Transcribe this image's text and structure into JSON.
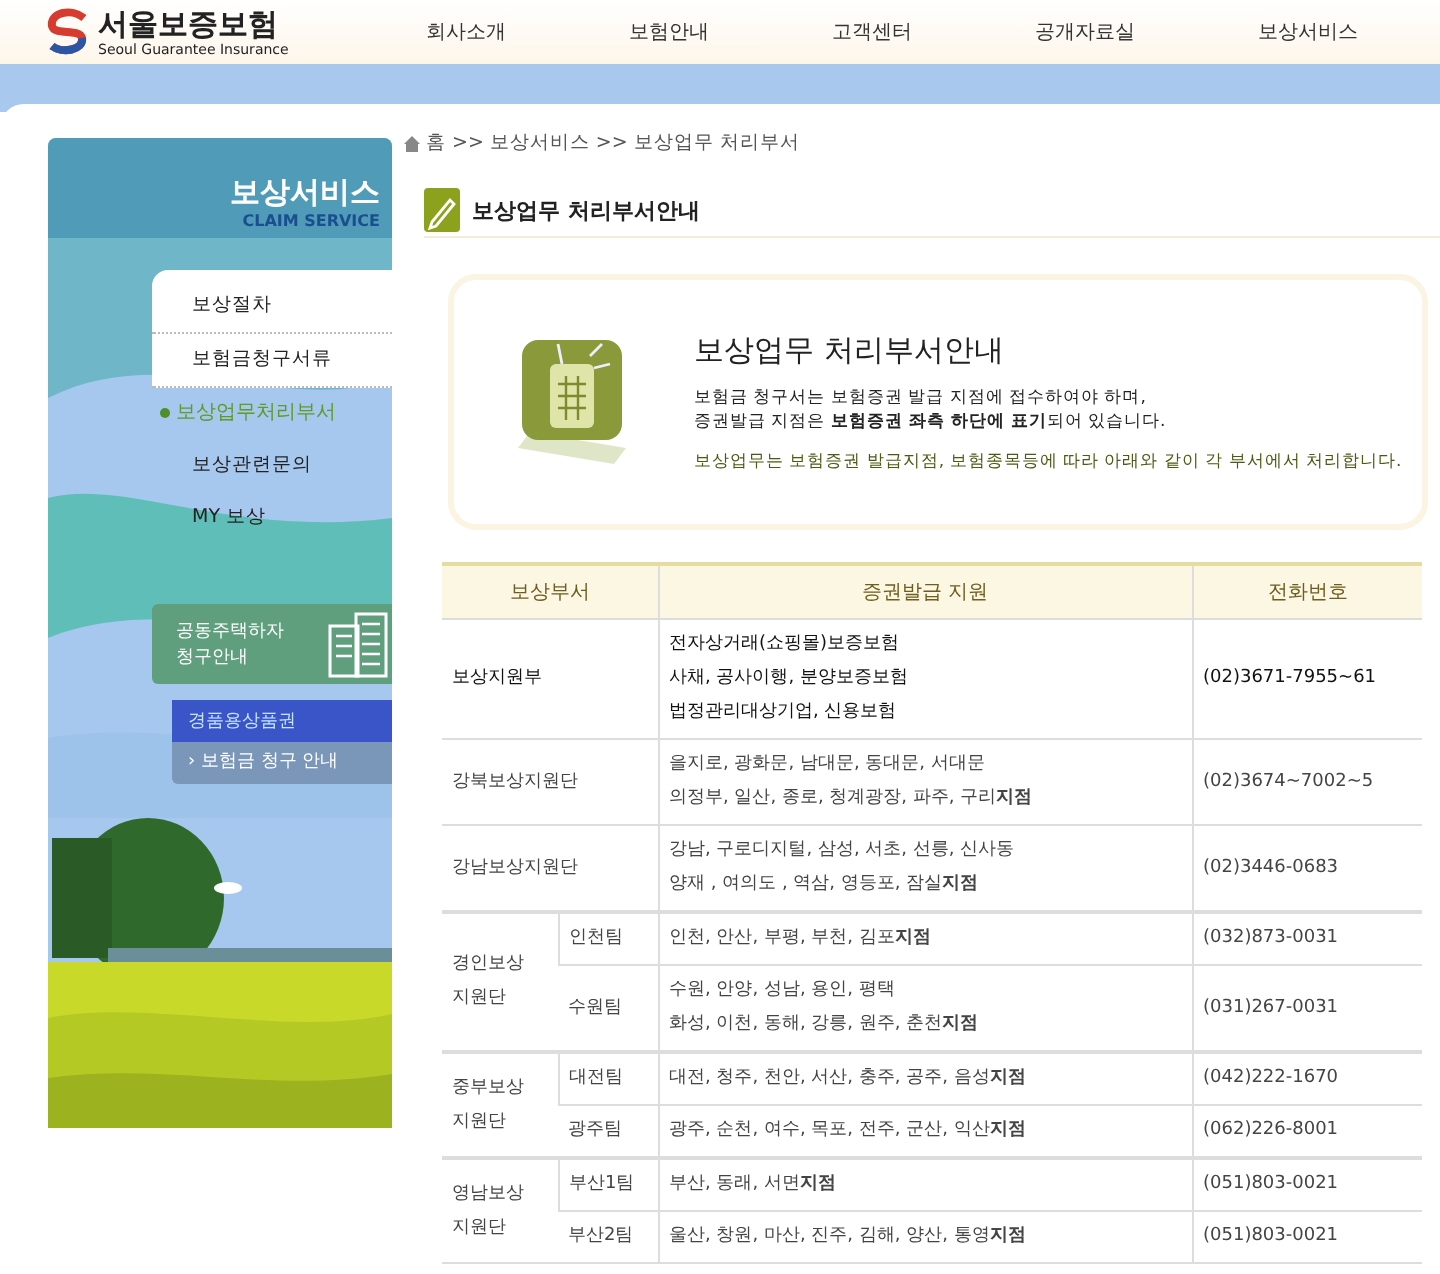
{
  "logo": {
    "name": "서울보증보험",
    "tagline": "Seoul Guarantee Insurance"
  },
  "nav": [
    "회사소개",
    "보험안내",
    "고객센터",
    "공개자료실",
    "보상서비스"
  ],
  "sidebar": {
    "title": "보상서비스",
    "subtitle": "CLAIM SERVICE",
    "items": [
      {
        "label": "보상절차",
        "selected": false
      },
      {
        "label": "보험금청구서류",
        "selected": false
      },
      {
        "label": "보상업무처리부서",
        "selected": true
      },
      {
        "label": "보상관련문의",
        "selected": false
      },
      {
        "label": "MY 보상",
        "selected": false
      }
    ],
    "banners": [
      {
        "kind": "housing",
        "text": "공동주택하자 청구안내"
      },
      {
        "kind": "voucher",
        "text": "경품용상품권",
        "link": "› 보험금 청구 안내"
      }
    ]
  },
  "breadcrumb": [
    "홈",
    ">>",
    "보상서비스",
    ">>",
    "보상업무 처리부서"
  ],
  "page_title": "보상업무 처리부서안내",
  "intro": {
    "heading": "보상업무 처리부서안내",
    "lines": [
      "보험금 청구서는 보험증권 발급 지점에 접수하여야 하며,",
      "증권발급 지점은 **보험증권 좌측 하단에 표기**되어 있습니다."
    ],
    "note": "보상업무는 보험증권 발급지점, 보험종목등에 따라 아래와 같이 각 부서에서 처리합니다."
  },
  "table": {
    "columns": [
      "보상부서",
      "증권발급 지원",
      "전화번호"
    ],
    "rows": [
      {
        "dept": "보상지원부",
        "branches": [
          "전자상거래(쇼핑몰)보증보험",
          "사채, 공사이행, 분양보증보험",
          "법정관리대상기업, 신용보험"
        ],
        "phone": "(02)3671-7955~61"
      },
      {
        "dept": "강북보상지원단",
        "branches": [
          "을지로, 광화문, 남대문, 동대문, 서대문",
          "의정부, 일산, 종로, 청계광장, 파주, 구리**지점**"
        ],
        "phone": "(02)3674~7002~5"
      },
      {
        "dept": "강남보상지원단",
        "branches": [
          "강남, 구로디지털, 삼성, 서초, 선릉, 신사동",
          "양재 , 여의도 , 역삼, 영등포, 잠실**지점**"
        ],
        "phone": "(02)3446-0683"
      },
      {
        "dept": "경인보상 지원단",
        "teams": [
          {
            "team": "인천팀",
            "branches": [
              "인천, 안산, 부평, 부천, 김포**지점**"
            ],
            "phone": "(032)873-0031"
          },
          {
            "team": "수원팀",
            "branches": [
              "수원, 안양, 성남, 용인, 평택",
              "화성, 이천, 동해, 강릉, 원주, 춘천**지점**"
            ],
            "phone": "(031)267-0031"
          }
        ]
      },
      {
        "dept": "중부보상 지원단",
        "teams": [
          {
            "team": "대전팀",
            "branches": [
              "대전, 청주, 천안, 서산, 충주, 공주, 음성**지점**"
            ],
            "phone": "(042)222-1670"
          },
          {
            "team": "광주팀",
            "branches": [
              "광주, 순천, 여수, 목포, 전주, 군산, 익산**지점**"
            ],
            "phone": "(062)226-8001"
          }
        ]
      },
      {
        "dept": "영남보상 지원단",
        "teams": [
          {
            "team": "부산1팀",
            "branches": [
              "부산, 동래, 서면**지점**"
            ],
            "phone": "(051)803-0021"
          },
          {
            "team": "부산2팀",
            "branches": [
              "울산, 창원, 마산, 진주, 김해, 양산, 통영**지점**"
            ],
            "phone": "(051)803-0021"
          }
        ]
      }
    ]
  }
}
